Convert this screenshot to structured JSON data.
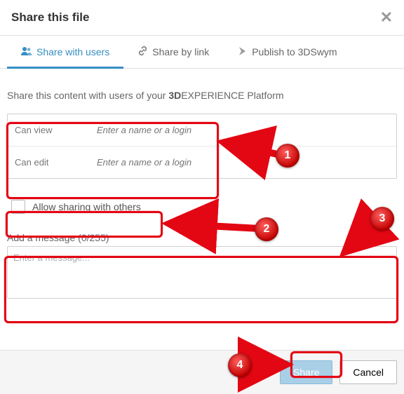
{
  "header": {
    "title": "Share this file"
  },
  "tabs": {
    "items": [
      {
        "label": "Share with users"
      },
      {
        "label": "Share by link"
      },
      {
        "label": "Publish to 3DSwym"
      }
    ]
  },
  "body": {
    "subtitle_pre": "Share this content with users of your ",
    "subtitle_bold": "3D",
    "subtitle_post": "EXPERIENCE Platform",
    "can_view_label": "Can view",
    "can_edit_label": "Can edit",
    "name_placeholder": "Enter a name or a login",
    "allow_label": "Allow sharing with others",
    "message_label": "Add a message (0/255)",
    "message_placeholder": "Enter a message..."
  },
  "footer": {
    "share": "Share",
    "cancel": "Cancel"
  },
  "annotations": {
    "badge1": "1",
    "badge2": "2",
    "badge3": "3",
    "badge4": "4"
  }
}
